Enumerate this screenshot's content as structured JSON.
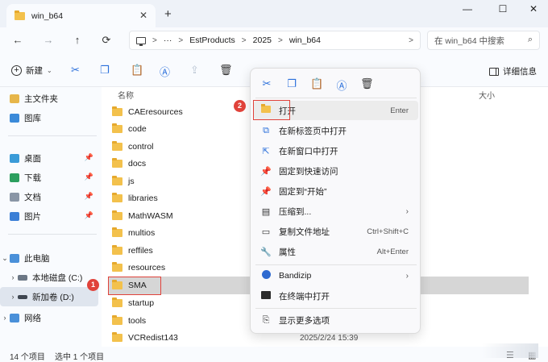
{
  "titlebar": {
    "tab_title": "win_b64",
    "close_tab": "✕",
    "new_tab": "+",
    "minimize": "—",
    "maximize": "☐",
    "close": "✕"
  },
  "nav": {
    "back": "←",
    "forward": "→",
    "up": "↑",
    "refresh": "⟳",
    "more": "···",
    "path": [
      "EstProducts",
      "2025",
      "win_b64"
    ],
    "search_placeholder": "在 win_b64 中搜索"
  },
  "commandbar": {
    "new_label": "新建",
    "details_label": "详细信息"
  },
  "sidebar": {
    "items": [
      {
        "label": "主文件夹",
        "icon": "home-icon"
      },
      {
        "label": "图库",
        "icon": "gallery-icon"
      },
      {
        "label": "桌面",
        "icon": "desktop-icon"
      },
      {
        "label": "下载",
        "icon": "download-icon"
      },
      {
        "label": "文档",
        "icon": "document-icon"
      },
      {
        "label": "图片",
        "icon": "picture-icon"
      },
      {
        "label": "此电脑",
        "icon": "pc-icon"
      },
      {
        "label": "本地磁盘 (C:)",
        "icon": "drive-icon"
      },
      {
        "label": "新加卷 (D:)",
        "icon": "drive-icon"
      },
      {
        "label": "网络",
        "icon": "network-icon"
      }
    ]
  },
  "filelist": {
    "col_name": "名称",
    "col_size": "大小",
    "rows": [
      "CAEresources",
      "code",
      "control",
      "docs",
      "js",
      "libraries",
      "MathWASM",
      "multios",
      "reffiles",
      "resources",
      "SMA",
      "startup",
      "tools",
      "VCRedist143"
    ],
    "last_date": "2025/2/24 15:39"
  },
  "status": {
    "count": "14 个项目",
    "selected": "选中 1 个项目"
  },
  "badges": {
    "one": "1",
    "two": "2"
  },
  "context_menu": {
    "items": [
      {
        "label": "打开",
        "shortcut": "Enter"
      },
      {
        "label": "在新标签页中打开"
      },
      {
        "label": "在新窗口中打开"
      },
      {
        "label": "固定到快速访问"
      },
      {
        "label": "固定到“开始”"
      },
      {
        "label": "压缩到..."
      },
      {
        "label": "复制文件地址",
        "shortcut": "Ctrl+Shift+C"
      },
      {
        "label": "属性",
        "shortcut": "Alt+Enter"
      },
      {
        "label": "Bandizip"
      },
      {
        "label": "在终端中打开"
      },
      {
        "label": "显示更多选项"
      }
    ]
  }
}
